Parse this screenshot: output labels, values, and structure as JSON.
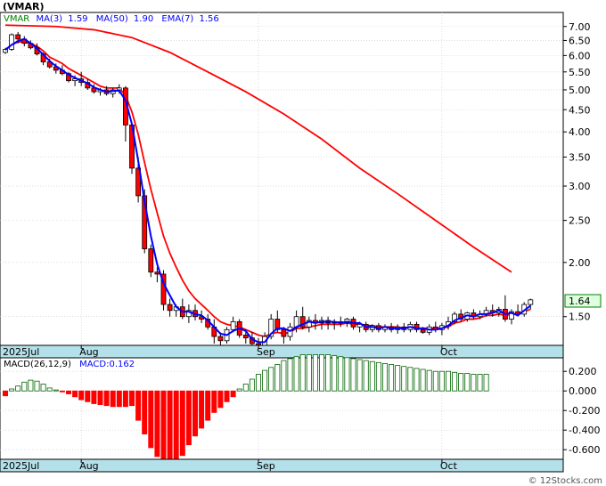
{
  "ticker_label": "(VMAR)",
  "watermark": "© 12Stocks.com",
  "last_price_label": "1.64",
  "colors": {
    "band": "#b4e0ea",
    "ma3": "#0000ff",
    "ma50": "#ff0000",
    "ema7": "#ff0000",
    "macd_pos": "#006400",
    "macd_neg": "#ff0000",
    "candle_up": "#ffffff",
    "candle_down": "#ff0000",
    "grid": "#c8c8c8"
  },
  "chart_data": [
    {
      "type": "candlestick",
      "title": "",
      "legend": {
        "symbol": "VMAR",
        "ma3": "MA(3)",
        "ma3_value": "1.59",
        "ma50": "MA(50)",
        "ma50_value": "1.90",
        "ema7": "EMA(7)",
        "ema7_value": "1.56"
      },
      "y_scale": "log",
      "ylim": [
        1.3,
        7.4
      ],
      "y_ticks": [
        "7.00",
        "6.50",
        "6.00",
        "5.50",
        "5.00",
        "4.50",
        "4.00",
        "3.50",
        "3.00",
        "2.50",
        "2.00",
        "1.50"
      ],
      "x_tick_labels": [
        {
          "label": "2025Jul",
          "index": 0
        },
        {
          "label": "Aug",
          "index": 12
        },
        {
          "label": "Sep",
          "index": 40
        },
        {
          "label": "Oct",
          "index": 69
        }
      ],
      "ohlc": [
        [
          6.1,
          6.25,
          6.05,
          6.2
        ],
        [
          6.2,
          6.75,
          6.15,
          6.7
        ],
        [
          6.7,
          6.8,
          6.4,
          6.55
        ],
        [
          6.55,
          6.65,
          6.3,
          6.4
        ],
        [
          6.4,
          6.5,
          6.2,
          6.25
        ],
        [
          6.25,
          6.4,
          6.0,
          6.05
        ],
        [
          6.05,
          6.1,
          5.7,
          5.8
        ],
        [
          5.8,
          5.9,
          5.6,
          5.65
        ],
        [
          5.65,
          5.75,
          5.45,
          5.55
        ],
        [
          5.55,
          5.7,
          5.4,
          5.45
        ],
        [
          5.45,
          5.5,
          5.2,
          5.25
        ],
        [
          5.25,
          5.4,
          5.1,
          5.3
        ],
        [
          5.3,
          5.5,
          5.1,
          5.2
        ],
        [
          5.2,
          5.3,
          5.0,
          5.05
        ],
        [
          5.05,
          5.15,
          4.9,
          4.95
        ],
        [
          4.95,
          5.05,
          4.85,
          5.0
        ],
        [
          5.0,
          5.1,
          4.85,
          4.9
        ],
        [
          4.9,
          5.05,
          4.8,
          5.0
        ],
        [
          5.0,
          5.15,
          4.9,
          5.05
        ],
        [
          5.05,
          5.1,
          3.8,
          4.15
        ],
        [
          4.15,
          4.2,
          3.2,
          3.3
        ],
        [
          3.3,
          3.5,
          2.75,
          2.85
        ],
        [
          2.85,
          2.95,
          2.1,
          2.15
        ],
        [
          2.15,
          2.2,
          1.85,
          1.9
        ],
        [
          1.9,
          1.95,
          1.8,
          1.88
        ],
        [
          1.88,
          1.92,
          1.55,
          1.6
        ],
        [
          1.6,
          1.65,
          1.5,
          1.55
        ],
        [
          1.55,
          1.6,
          1.5,
          1.58
        ],
        [
          1.58,
          1.65,
          1.48,
          1.5
        ],
        [
          1.5,
          1.6,
          1.45,
          1.55
        ],
        [
          1.55,
          1.6,
          1.47,
          1.5
        ],
        [
          1.5,
          1.55,
          1.45,
          1.48
        ],
        [
          1.48,
          1.52,
          1.4,
          1.42
        ],
        [
          1.42,
          1.48,
          1.3,
          1.35
        ],
        [
          1.35,
          1.38,
          1.28,
          1.32
        ],
        [
          1.32,
          1.42,
          1.3,
          1.4
        ],
        [
          1.4,
          1.5,
          1.38,
          1.46
        ],
        [
          1.46,
          1.48,
          1.34,
          1.36
        ],
        [
          1.36,
          1.4,
          1.3,
          1.34
        ],
        [
          1.34,
          1.38,
          1.28,
          1.3
        ],
        [
          1.3,
          1.34,
          1.26,
          1.28
        ],
        [
          1.28,
          1.38,
          1.27,
          1.35
        ],
        [
          1.35,
          1.52,
          1.33,
          1.48
        ],
        [
          1.48,
          1.55,
          1.38,
          1.4
        ],
        [
          1.4,
          1.42,
          1.3,
          1.35
        ],
        [
          1.35,
          1.45,
          1.32,
          1.42
        ],
        [
          1.42,
          1.55,
          1.38,
          1.5
        ],
        [
          1.5,
          1.58,
          1.4,
          1.42
        ],
        [
          1.42,
          1.5,
          1.38,
          1.47
        ],
        [
          1.47,
          1.52,
          1.4,
          1.45
        ],
        [
          1.45,
          1.5,
          1.4,
          1.47
        ],
        [
          1.47,
          1.5,
          1.4,
          1.45
        ],
        [
          1.45,
          1.48,
          1.4,
          1.46
        ],
        [
          1.46,
          1.5,
          1.42,
          1.45
        ],
        [
          1.45,
          1.49,
          1.42,
          1.48
        ],
        [
          1.48,
          1.5,
          1.4,
          1.42
        ],
        [
          1.42,
          1.46,
          1.38,
          1.44
        ],
        [
          1.44,
          1.46,
          1.38,
          1.4
        ],
        [
          1.4,
          1.44,
          1.38,
          1.43
        ],
        [
          1.43,
          1.45,
          1.38,
          1.4
        ],
        [
          1.4,
          1.44,
          1.38,
          1.42
        ],
        [
          1.42,
          1.45,
          1.38,
          1.4
        ],
        [
          1.4,
          1.44,
          1.37,
          1.42
        ],
        [
          1.42,
          1.45,
          1.38,
          1.4
        ],
        [
          1.4,
          1.46,
          1.38,
          1.44
        ],
        [
          1.44,
          1.46,
          1.38,
          1.4
        ],
        [
          1.4,
          1.42,
          1.37,
          1.38
        ],
        [
          1.38,
          1.44,
          1.36,
          1.42
        ],
        [
          1.42,
          1.46,
          1.38,
          1.4
        ],
        [
          1.4,
          1.45,
          1.36,
          1.43
        ],
        [
          1.43,
          1.5,
          1.4,
          1.46
        ],
        [
          1.46,
          1.54,
          1.44,
          1.52
        ],
        [
          1.52,
          1.56,
          1.46,
          1.48
        ],
        [
          1.48,
          1.54,
          1.46,
          1.53
        ],
        [
          1.53,
          1.56,
          1.48,
          1.5
        ],
        [
          1.5,
          1.55,
          1.48,
          1.52
        ],
        [
          1.52,
          1.58,
          1.5,
          1.55
        ],
        [
          1.55,
          1.6,
          1.5,
          1.53
        ],
        [
          1.53,
          1.58,
          1.5,
          1.56
        ],
        [
          1.56,
          1.68,
          1.46,
          1.48
        ],
        [
          1.48,
          1.56,
          1.44,
          1.54
        ],
        [
          1.54,
          1.6,
          1.5,
          1.52
        ],
        [
          1.52,
          1.62,
          1.5,
          1.6
        ],
        [
          1.6,
          1.65,
          1.56,
          1.64
        ]
      ],
      "ma3": [
        6.18,
        6.35,
        6.48,
        6.55,
        6.4,
        6.23,
        6.03,
        5.83,
        5.67,
        5.55,
        5.42,
        5.33,
        5.25,
        5.18,
        5.07,
        5.0,
        4.95,
        4.97,
        4.98,
        4.73,
        4.17,
        3.43,
        2.77,
        2.3,
        1.98,
        1.79,
        1.68,
        1.58,
        1.54,
        1.54,
        1.52,
        1.51,
        1.47,
        1.42,
        1.37,
        1.36,
        1.39,
        1.41,
        1.39,
        1.33,
        1.31,
        1.31,
        1.37,
        1.41,
        1.41,
        1.39,
        1.42,
        1.44,
        1.46,
        1.45,
        1.46,
        1.46,
        1.46,
        1.45,
        1.46,
        1.45,
        1.45,
        1.42,
        1.42,
        1.41,
        1.42,
        1.41,
        1.41,
        1.41,
        1.42,
        1.41,
        1.41,
        1.4,
        1.4,
        1.41,
        1.43,
        1.47,
        1.49,
        1.51,
        1.5,
        1.52,
        1.52,
        1.53,
        1.55,
        1.52,
        1.53,
        1.51,
        1.55,
        1.59
      ],
      "ema7": [
        6.2,
        6.35,
        6.45,
        6.45,
        6.4,
        6.3,
        6.15,
        5.95,
        5.85,
        5.75,
        5.6,
        5.5,
        5.4,
        5.3,
        5.2,
        5.1,
        5.05,
        5.05,
        5.05,
        4.85,
        4.45,
        3.95,
        3.4,
        2.95,
        2.6,
        2.3,
        2.1,
        1.95,
        1.82,
        1.72,
        1.65,
        1.6,
        1.55,
        1.5,
        1.46,
        1.44,
        1.43,
        1.42,
        1.4,
        1.38,
        1.36,
        1.35,
        1.37,
        1.38,
        1.37,
        1.38,
        1.41,
        1.41,
        1.42,
        1.43,
        1.44,
        1.44,
        1.44,
        1.44,
        1.45,
        1.44,
        1.44,
        1.43,
        1.43,
        1.42,
        1.42,
        1.42,
        1.42,
        1.41,
        1.42,
        1.41,
        1.41,
        1.41,
        1.41,
        1.41,
        1.42,
        1.45,
        1.46,
        1.48,
        1.48,
        1.49,
        1.51,
        1.51,
        1.52,
        1.51,
        1.52,
        1.52,
        1.54,
        1.56
      ],
      "ma50": [
        [
          0,
          7.05
        ],
        [
          8,
          7.0
        ],
        [
          14,
          6.88
        ],
        [
          20,
          6.6
        ],
        [
          26,
          6.1
        ],
        [
          32,
          5.5
        ],
        [
          38,
          4.95
        ],
        [
          44,
          4.4
        ],
        [
          50,
          3.85
        ],
        [
          56,
          3.3
        ],
        [
          62,
          2.88
        ],
        [
          68,
          2.5
        ],
        [
          74,
          2.17
        ],
        [
          80,
          1.9
        ]
      ]
    },
    {
      "type": "bar",
      "title": "",
      "legend": {
        "label": "MACD(26,12,9)",
        "value_label": "MACD:0.162"
      },
      "ylim": [
        -0.68,
        0.32
      ],
      "y_ticks": [
        "0.200",
        "0.000",
        "-0.200",
        "-0.400",
        "-0.600"
      ],
      "values": [
        -0.05,
        0.02,
        0.05,
        0.09,
        0.11,
        0.1,
        0.07,
        0.03,
        0.01,
        -0.01,
        -0.03,
        -0.06,
        -0.09,
        -0.11,
        -0.13,
        -0.14,
        -0.15,
        -0.16,
        -0.16,
        -0.16,
        -0.15,
        -0.3,
        -0.44,
        -0.58,
        -0.67,
        -0.7,
        -0.72,
        -0.73,
        -0.66,
        -0.55,
        -0.46,
        -0.38,
        -0.3,
        -0.22,
        -0.17,
        -0.11,
        -0.06,
        0.02,
        0.07,
        0.12,
        0.17,
        0.21,
        0.24,
        0.27,
        0.31,
        0.33,
        0.35,
        0.37,
        0.37,
        0.37,
        0.37,
        0.37,
        0.36,
        0.35,
        0.34,
        0.33,
        0.32,
        0.31,
        0.3,
        0.29,
        0.28,
        0.27,
        0.26,
        0.25,
        0.24,
        0.23,
        0.22,
        0.21,
        0.2,
        0.2,
        0.2,
        0.19,
        0.18,
        0.18,
        0.17,
        0.17,
        0.17
      ]
    }
  ]
}
